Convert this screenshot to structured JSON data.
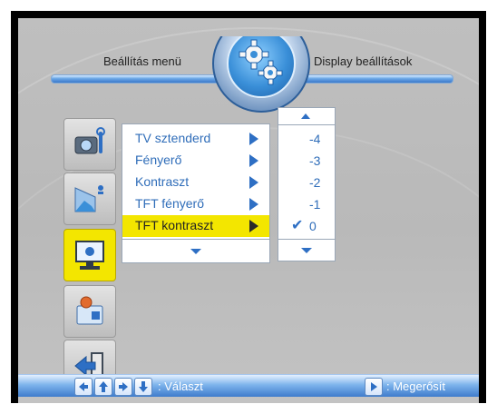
{
  "header": {
    "left_title": "Beállítás menü",
    "right_title": "Display beállítások",
    "gear_icon": "gear-icon"
  },
  "sidebar": {
    "items": [
      {
        "icon": "camera-settings-icon",
        "selected": false
      },
      {
        "icon": "picture-settings-icon",
        "selected": false
      },
      {
        "icon": "display-settings-icon",
        "selected": true
      },
      {
        "icon": "system-settings-icon",
        "selected": false
      },
      {
        "icon": "exit-icon",
        "selected": false
      }
    ]
  },
  "menu": {
    "items": [
      {
        "label": "TV sztenderd"
      },
      {
        "label": "Fényerő"
      },
      {
        "label": "Kontraszt"
      },
      {
        "label": "TFT fényerő"
      },
      {
        "label": "TFT kontraszt"
      }
    ],
    "selected_index": 4
  },
  "values": {
    "items": [
      "-4",
      "-3",
      "-2",
      "-1",
      "0"
    ],
    "checked_index": 4,
    "check_mark": "✔"
  },
  "footer": {
    "select_label": ": Választ",
    "confirm_label": ": Megerősít"
  },
  "colors": {
    "accent_blue": "#2e6fc4",
    "highlight_yellow": "#f3e600",
    "background_gray": "#bdbdbd"
  }
}
